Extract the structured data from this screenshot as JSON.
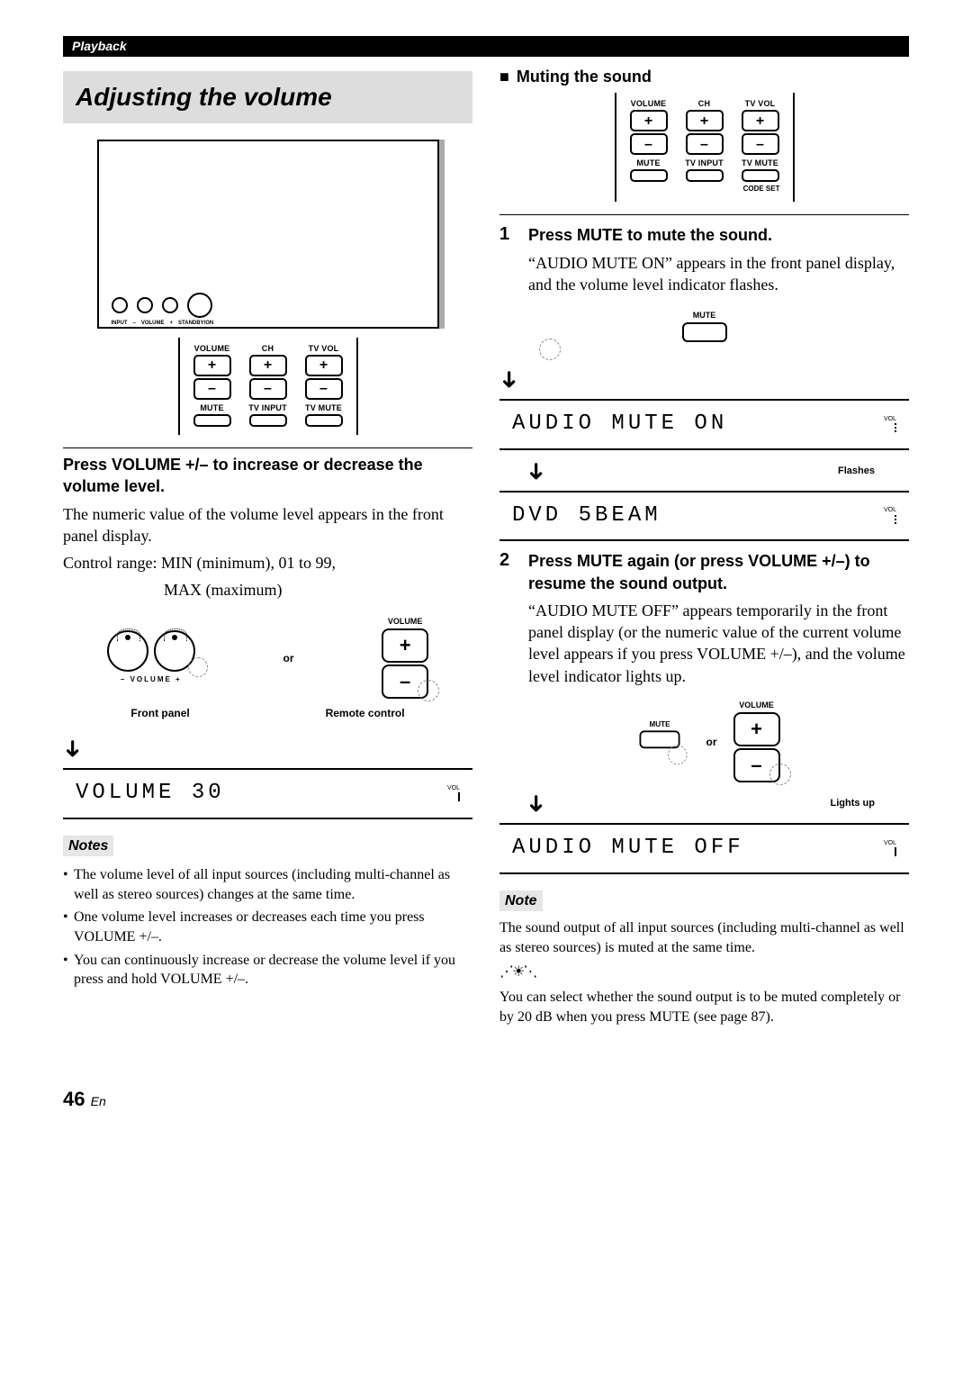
{
  "header": {
    "section": "Playback"
  },
  "left": {
    "title": "Adjusting the volume",
    "device_labels": {
      "input": "INPUT",
      "volminus": "–",
      "vol": "VOLUME",
      "volplus": "+",
      "standby": "STANDBY/ON"
    },
    "remote": {
      "col1": "VOLUME",
      "col2": "CH",
      "col3": "TV VOL",
      "plus": "+",
      "minus": "–",
      "row2a": "MUTE",
      "row2b": "TV INPUT",
      "row2c": "TV MUTE"
    },
    "instr_bold": "Press VOLUME +/– to increase or decrease the volume level.",
    "instr_body": "The numeric value of the volume level appears in the front panel display.",
    "range1": "Control range: MIN (minimum), 01 to 99,",
    "range2": "MAX (maximum)",
    "volctrl": {
      "volume_label": "VOLUME",
      "volpm": "–   VOLUME   +",
      "or": "or",
      "front": "Front panel",
      "remote": "Remote control"
    },
    "lcd_volume": "VOLUME   30",
    "lcd_vol_label": "VOL",
    "notes_head": "Notes",
    "notes": [
      "The volume level of all input sources (including multi-channel as well as stereo sources) changes at the same time.",
      "One volume level increases or decreases each time you press VOLUME +/–.",
      "You can continuously increase or decrease the volume level if you press and hold VOLUME +/–."
    ]
  },
  "right": {
    "sub": "Muting the sound",
    "remote": {
      "col1": "VOLUME",
      "col2": "CH",
      "col3": "TV VOL",
      "plus": "+",
      "minus": "–",
      "row2a": "MUTE",
      "row2b": "TV INPUT",
      "row2c": "TV MUTE",
      "codeset": "CODE SET"
    },
    "step1_bold": "Press MUTE to mute the sound.",
    "step1_body": "“AUDIO MUTE ON” appears in the front panel display, and the volume level indicator flashes.",
    "mute_label": "MUTE",
    "lcd_mute_on": "AUDIO MUTE ON",
    "vol_tiny": "VOL",
    "flashes": "Flashes",
    "lcd_dvd": "DVD      5BEAM",
    "step2_bold": "Press MUTE again (or press VOLUME +/–) to resume the sound output.",
    "step2_body": "“AUDIO MUTE OFF” appears temporarily in the front panel display (or the numeric value of the current volume level appears if you press VOLUME +/–), and the volume level indicator lights up.",
    "or": "or",
    "volume_label": "VOLUME",
    "lights_up": "Lights up",
    "lcd_mute_off": "AUDIO MUTE OFF",
    "note_head": "Note",
    "note_body": "The sound output of all input sources (including multi-channel as well as stereo sources) is muted at the same time.",
    "tip": "You can select whether the sound output is to be muted completely or by 20 dB when you press MUTE (see page 87)."
  },
  "page": {
    "num": "46",
    "lang": "En"
  }
}
